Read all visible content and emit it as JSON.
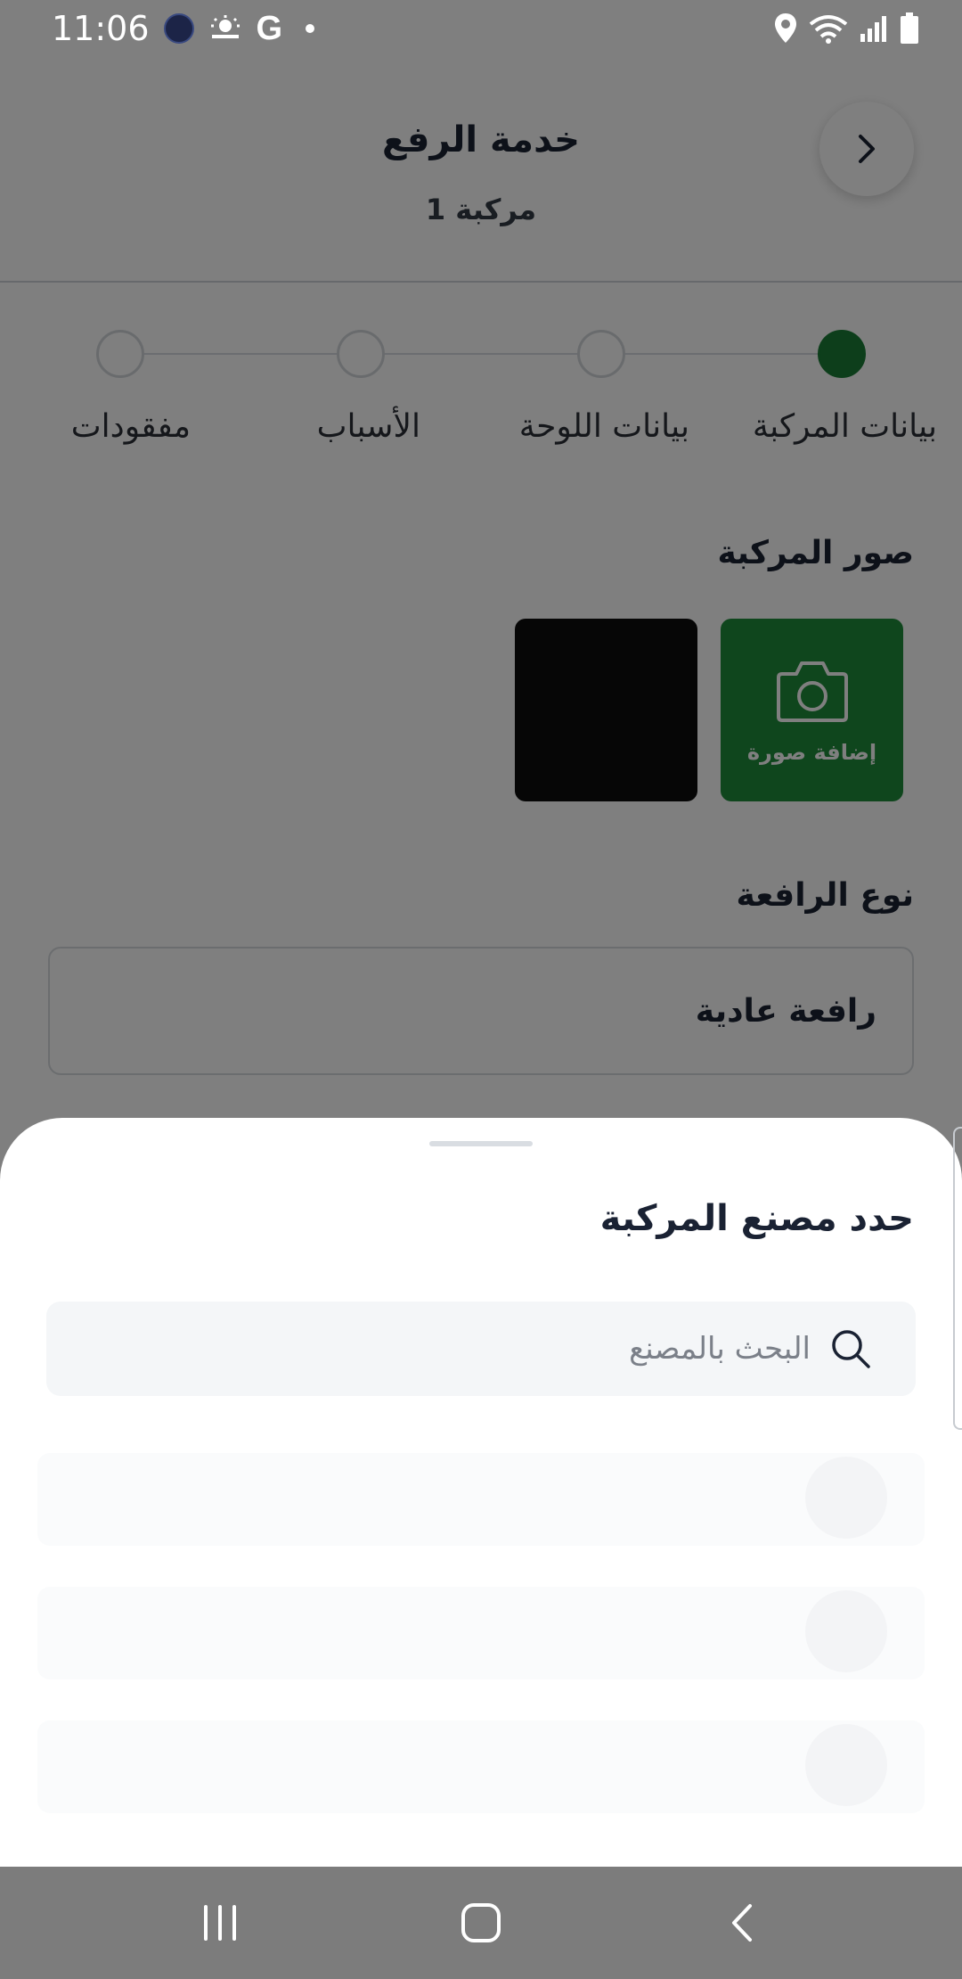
{
  "status_bar": {
    "time": "11:06",
    "left_icons": [
      "app-badge-icon",
      "weather-icon",
      "google-icon",
      "notification-dot-icon"
    ],
    "right_icons": [
      "location-icon",
      "wifi-icon",
      "signal-icon",
      "battery-icon"
    ],
    "google_letter": "G"
  },
  "header": {
    "title": "خدمة الرفع",
    "subtitle": "مركبة 1",
    "back_icon": "chevron-right-icon"
  },
  "stepper": {
    "steps": [
      {
        "label": "بيانات المركبة",
        "active": true
      },
      {
        "label": "بيانات اللوحة",
        "active": false
      },
      {
        "label": "الأسباب",
        "active": false
      },
      {
        "label": "مفقودات",
        "active": false
      }
    ]
  },
  "photos_section": {
    "title": "صور المركبة",
    "add_photo_label": "إضافة صورة",
    "add_photo_icon": "camera-icon"
  },
  "lift_type_section": {
    "title": "نوع الرافعة",
    "selected_value": "رافعة عادية"
  },
  "sheet": {
    "title": "حدد مصنع المركبة",
    "search": {
      "placeholder": "البحث بالمصنع",
      "value": "",
      "icon": "search-icon"
    },
    "loading_rows": 3
  },
  "nav_bar": {
    "buttons": [
      "recent-apps-icon",
      "home-icon",
      "back-icon"
    ]
  },
  "colors": {
    "accent": "#1e8c3b",
    "active_step": "#1a7d36",
    "text_primary": "#1a2233",
    "search_bg": "#f4f6f8"
  }
}
